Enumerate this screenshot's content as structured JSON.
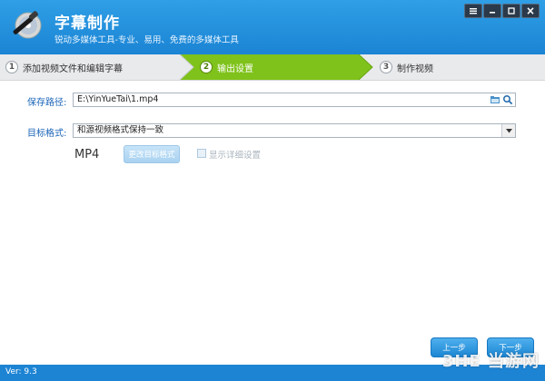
{
  "app": {
    "title": "字幕制作",
    "subtitle": "锐动多媒体工具-专业、易用、免费的多媒体工具"
  },
  "steps": [
    {
      "num": "1",
      "label": "添加视频文件和编辑字幕",
      "state": "done"
    },
    {
      "num": "2",
      "label": "输出设置",
      "state": "active"
    },
    {
      "num": "3",
      "label": "制作视频",
      "state": "pending"
    }
  ],
  "form": {
    "save_path_label": "保存路径:",
    "save_path_value": "E:\\YinYueTai\\1.mp4",
    "target_format_label": "目标格式:",
    "target_format_value": "和源视频格式保持一致",
    "format_name": "MP4",
    "change_format_button": "更改目标格式",
    "show_details_label": "显示详细设置"
  },
  "nav": {
    "prev_label": "上一步",
    "next_label": "下一步"
  },
  "status": {
    "version": "Ver: 9.3"
  },
  "watermark": "3HE 当游网",
  "colors": {
    "titlebar": "#1b84d4",
    "active_step": "#7fc21b",
    "accent": "#1a64b8"
  }
}
